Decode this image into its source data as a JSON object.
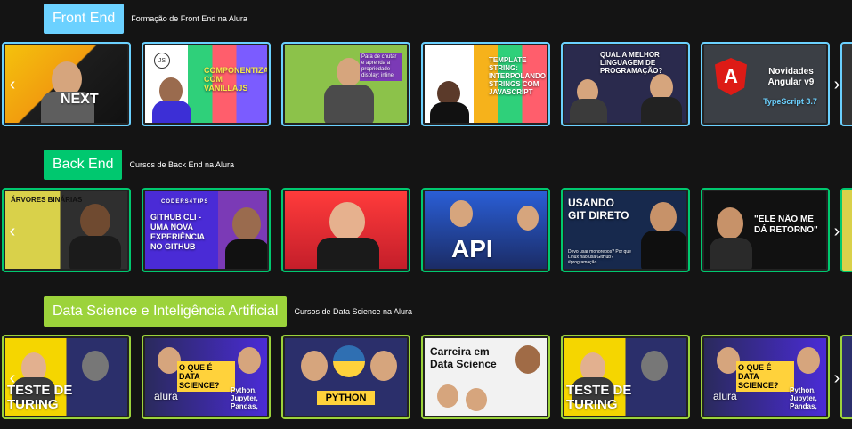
{
  "sections": [
    {
      "title": "Front End",
      "subtitle": "Formação de Front End na Alura",
      "accent": "#6BD1FF",
      "cards": [
        {
          "text": "NEXT"
        },
        {
          "text": "COMPONENTIZAÇÃO COM VANILLAJS"
        },
        {
          "text": "Para de chutar e aprenda a propriedade display: inline"
        },
        {
          "text": "TEMPLATE STRING: INTERPOLANDO STRINGS COM JAVASCRIPT"
        },
        {
          "text": "QUAL A MELHOR LINGUAGEM DE PROGRAMAÇÃO?"
        },
        {
          "text": "Novidades Angular v9",
          "extra": "TypeScript 3.7"
        }
      ]
    },
    {
      "title": "Back End",
      "subtitle": "Cursos de Back End na Alura",
      "accent": "#00C86F",
      "cards": [
        {
          "text": "ÁRVORES BINÁRIAS"
        },
        {
          "text": "GITHUB CLI - UMA NOVA EXPERIÊNCIA NO GITHUB",
          "extra": "CODERS4TIPS"
        },
        {
          "text": ""
        },
        {
          "text": "API"
        },
        {
          "text": "USANDO GIT DIRETO",
          "extra": "Devo usar monorepos? Por que Linux não usa GitHub? #programação"
        },
        {
          "text": "\"ELE NÃO ME DÁ RETORNO\""
        }
      ]
    },
    {
      "title": "Data Science e Inteligência Artificial",
      "subtitle": "Cursos de Data Science na Alura",
      "accent": "#9CD33B",
      "cards": [
        {
          "text": "TESTE DE TURING"
        },
        {
          "text": "O QUE É DATA SCIENCE?",
          "extra": "Python, Jupyter, Pandas,"
        },
        {
          "text": "PYTHON"
        },
        {
          "text": "Carreira em Data Science"
        },
        {
          "text": "TESTE DE TURING"
        },
        {
          "text": "O QUE É DATA SCIENCE?",
          "extra": "Python, Jupyter, Pandas,"
        }
      ]
    }
  ],
  "arrows": {
    "left": "‹",
    "right": "›"
  },
  "icons": {
    "angular_letter": "A",
    "alura_logo": "alura",
    "js_badge": "JS"
  }
}
